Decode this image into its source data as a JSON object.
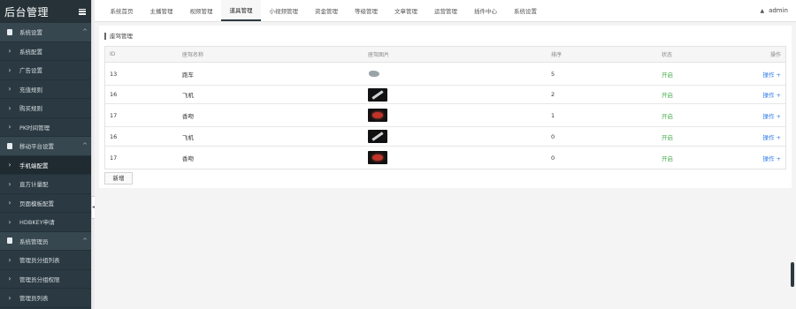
{
  "app_title": "后台管理",
  "sidebar": {
    "items": [
      {
        "label": "系统设置",
        "type": "group",
        "chevron": "^"
      },
      {
        "label": "系统配置",
        "type": "item",
        "chevron": ""
      },
      {
        "label": "广告设置",
        "type": "item",
        "chevron": ""
      },
      {
        "label": "充值规则",
        "type": "item",
        "chevron": ""
      },
      {
        "label": "购买规则",
        "type": "item",
        "chevron": ""
      },
      {
        "label": "PK时间管理",
        "type": "item",
        "chevron": ""
      },
      {
        "label": "移动平台设置",
        "type": "group",
        "chevron": "^"
      },
      {
        "label": "手机端配置",
        "type": "item",
        "chevron": "",
        "active": true
      },
      {
        "label": "直方计量配",
        "type": "item",
        "chevron": ""
      },
      {
        "label": "页面模板配置",
        "type": "item",
        "chevron": ""
      },
      {
        "label": "HDBKEY申请",
        "type": "item",
        "chevron": ""
      },
      {
        "label": "系统管理员",
        "type": "group",
        "chevron": "^"
      },
      {
        "label": "管理员分组列表",
        "type": "item",
        "chevron": ""
      },
      {
        "label": "管理员分组权限",
        "type": "item",
        "chevron": ""
      },
      {
        "label": "管理员列表",
        "type": "item",
        "chevron": ""
      }
    ]
  },
  "topnav": {
    "items": [
      "系统首页",
      "主播管理",
      "视频管理",
      "道具管理",
      "小视频管理",
      "资金管理",
      "等级管理",
      "文章管理",
      "运营管理",
      "插件中心",
      "系统设置"
    ],
    "active_index": 3
  },
  "user": {
    "name": "admin"
  },
  "panel": {
    "title": "座驾管理",
    "add_label": "新增"
  },
  "table": {
    "headers": {
      "id": "ID",
      "name": "座驾名称",
      "image": "座驾图片",
      "sort": "排序",
      "status": "状态",
      "op": "操作"
    },
    "rows": [
      {
        "id": "13",
        "name": "跑车",
        "image": "car-thumbnail",
        "sort": "5",
        "status": "开启",
        "op": "操作 +"
      },
      {
        "id": "16",
        "name": "飞机",
        "image": "plane-thumbnail",
        "sort": "2",
        "status": "开启",
        "op": "操作 +"
      },
      {
        "id": "17",
        "name": "香吻",
        "image": "kiss-thumbnail",
        "sort": "1",
        "status": "开启",
        "op": "操作 +"
      },
      {
        "id": "16",
        "name": "飞机",
        "image": "plane-thumbnail",
        "sort": "0",
        "status": "开启",
        "op": "操作 +"
      },
      {
        "id": "17",
        "name": "香吻",
        "image": "kiss-thumbnail",
        "sort": "0",
        "status": "开启",
        "op": "操作 +"
      }
    ]
  },
  "colors": {
    "sidebar_bg": "#2b3a42",
    "brand_bg": "#263238",
    "status_on": "#4caf50",
    "link": "#2c7be5"
  }
}
